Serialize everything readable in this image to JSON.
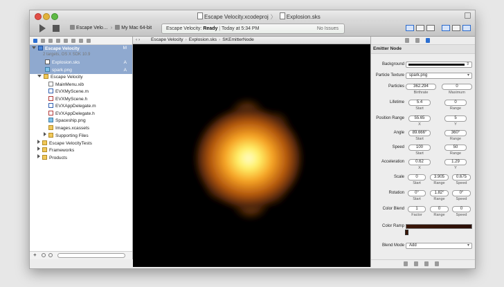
{
  "window": {
    "title_project": "Escape Velocity.xcodeproj",
    "title_file": "Explosion.sks"
  },
  "toolbar": {
    "scheme": "Escape Velo…",
    "destination": "My Mac 64-bit",
    "activity_status_name": "Escape Velocity:",
    "activity_status_state": "Ready",
    "activity_time": "Today at 5:34 PM",
    "issues": "No Issues"
  },
  "navigator": {
    "project": {
      "name": "Escape Velocity",
      "subtitle": "2 targets, OS X SDK 10.9",
      "badge": "M"
    },
    "items": [
      {
        "label": "Explosion.sks",
        "badge": "A"
      },
      {
        "label": "spark.png",
        "badge": "A"
      },
      {
        "label": "Escape Velocity"
      },
      {
        "label": "MainMenu.xib"
      },
      {
        "label": "EVXMyScene.m"
      },
      {
        "label": "EVXMyScene.h"
      },
      {
        "label": "EVXAppDelegate.m"
      },
      {
        "label": "EVXAppDelegate.h"
      },
      {
        "label": "Spaceship.png"
      },
      {
        "label": "Images.xcassets"
      },
      {
        "label": "Supporting Files"
      },
      {
        "label": "Escape VelocityTests"
      },
      {
        "label": "Frameworks"
      },
      {
        "label": "Products"
      }
    ],
    "footer_plus": "+"
  },
  "editor": {
    "crumbs": [
      "Escape Velocity",
      "Explosion.sks",
      "SKEmitterNode"
    ],
    "nav_arrows": "‹ ›"
  },
  "inspector": {
    "title": "Emitter Node",
    "background_label": "Background",
    "texture_label": "Particle Texture",
    "texture_value": "spark.png",
    "particles": {
      "label": "Particles",
      "a": "362.294",
      "a_sub": "Birthrate",
      "b": "0",
      "b_sub": "Maximum"
    },
    "lifetime": {
      "label": "Lifetime",
      "a": "5.4",
      "a_sub": "Start",
      "b": "0",
      "b_sub": "Range"
    },
    "position_range": {
      "label": "Position Range",
      "a": "55.65",
      "a_sub": "X",
      "b": "5",
      "b_sub": "Y"
    },
    "angle": {
      "label": "Angle",
      "a": "89.666°",
      "a_sub": "Start",
      "b": "360°",
      "b_sub": "Range"
    },
    "speed": {
      "label": "Speed",
      "a": "100",
      "a_sub": "Start",
      "b": "50",
      "b_sub": "Range"
    },
    "acceleration": {
      "label": "Acceleration",
      "a": "0.62",
      "a_sub": "X",
      "b": "1.29",
      "b_sub": "Y"
    },
    "scale": {
      "label": "Scale",
      "a": "0",
      "a_sub": "Start",
      "b": "3.905",
      "b_sub": "Range",
      "c": "0.675",
      "c_sub": "Speed"
    },
    "rotation": {
      "label": "Rotation",
      "a": "0°",
      "a_sub": "Start",
      "b": "1.82°",
      "b_sub": "Range",
      "c": "0°",
      "c_sub": "Speed"
    },
    "color_blend": {
      "label": "Color Blend",
      "a": "1",
      "a_sub": "Factor",
      "b": "0",
      "b_sub": "Range",
      "c": "0",
      "c_sub": "Speed"
    },
    "color_ramp_label": "Color Ramp",
    "blend_mode_label": "Blend Mode",
    "blend_mode_value": "Add"
  },
  "colors": {
    "selection": "#8fa9cf",
    "canvas_bg": "#000000",
    "fire_core": "#fff36a",
    "fire_mid": "#f7a324",
    "fire_edge": "#7a3a0a"
  }
}
